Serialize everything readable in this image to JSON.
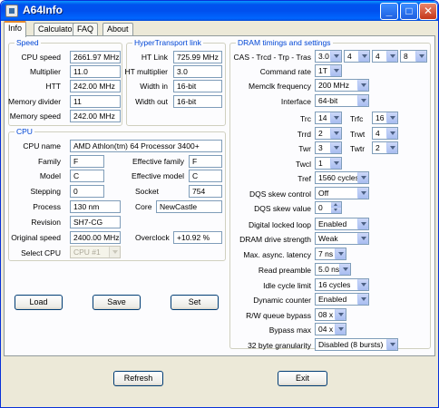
{
  "window": {
    "title": "A64Info",
    "minimize": "_",
    "maximize": "□",
    "close": "✕"
  },
  "tabs": [
    "Info",
    "Calculator",
    "FAQ",
    "About"
  ],
  "speed": {
    "group_label": "Speed",
    "cpu_speed_label": "CPU speed",
    "cpu_speed": "2661.97 MHz",
    "multiplier_label": "Multiplier",
    "multiplier": "11.0",
    "htt_label": "HTT",
    "htt": "242.00 MHz",
    "memory_divider_label": "Memory divider",
    "memory_divider": "11",
    "memory_speed_label": "Memory speed",
    "memory_speed": "242.00 MHz"
  },
  "ht": {
    "group_label": "HyperTransport link",
    "link_label": "HT Link",
    "link": "725.99 MHz",
    "multiplier_label": "HT multiplier",
    "multiplier": "3.0",
    "width_in_label": "Width in",
    "width_in": "16-bit",
    "width_out_label": "Width out",
    "width_out": "16-bit"
  },
  "cpu": {
    "group_label": "CPU",
    "name_label": "CPU name",
    "name": "AMD Athlon(tm) 64 Processor 3400+",
    "family_label": "Family",
    "family": "F",
    "eff_family_label": "Effective family",
    "eff_family": "F",
    "model_label": "Model",
    "model": "C",
    "eff_model_label": "Effective model",
    "eff_model": "C",
    "stepping_label": "Stepping",
    "stepping": "0",
    "socket_label": "Socket",
    "socket": "754",
    "process_label": "Process",
    "process": "130 nm",
    "core_label": "Core",
    "core": "NewCastle",
    "revision_label": "Revision",
    "revision": "SH7-CG",
    "orig_speed_label": "Original speed",
    "orig_speed": "2400.00 MHz",
    "overclock_label": "Overclock",
    "overclock": "+10.92 %",
    "select_cpu_label": "Select CPU",
    "select_cpu": "CPU #1"
  },
  "buttons": {
    "load": "Load",
    "save": "Save",
    "set": "Set",
    "refresh": "Refresh",
    "exit": "Exit"
  },
  "dram": {
    "group_label": "DRAM timings and settings",
    "cas_label": "CAS - Trcd - Trp - Tras",
    "cas": "3.0",
    "trcd": "4",
    "trp": "4",
    "tras": "8",
    "command_rate_label": "Command rate",
    "command_rate": "1T",
    "memclk_label": "Memclk frequency",
    "memclk": "200 MHz",
    "interface_label": "Interface",
    "interface": "64-bit",
    "trc_label": "Trc",
    "trc": "14",
    "trfc_label": "Trfc",
    "trfc": "16",
    "trrd_label": "Trrd",
    "trrd": "2",
    "trwt_label": "Trwt",
    "trwt": "4",
    "twr_label": "Twr",
    "twr": "3",
    "twtr_label": "Twtr",
    "twtr": "2",
    "twcl_label": "Twcl",
    "twcl": "1",
    "tref_label": "Tref",
    "tref": "1560 cycles",
    "dqs_ctrl_label": "DQS skew control",
    "dqs_ctrl": "Off",
    "dqs_val_label": "DQS skew value",
    "dqs_val": "0",
    "dll_label": "Digital locked loop",
    "dll": "Enabled",
    "drive_label": "DRAM drive strength",
    "drive": "Weak",
    "async_label": "Max. async. latency",
    "async": "7 ns",
    "preamble_label": "Read preamble",
    "preamble": "5.0 ns",
    "idle_label": "Idle cycle limit",
    "idle": "16 cycles",
    "dyn_label": "Dynamic counter",
    "dyn": "Enabled",
    "rw_label": "R/W queue bypass",
    "rw": "08 x",
    "bypass_label": "Bypass max",
    "bypass": "04 x",
    "gran_label": "32 byte granularity",
    "gran": "Disabled (8 bursts)"
  }
}
